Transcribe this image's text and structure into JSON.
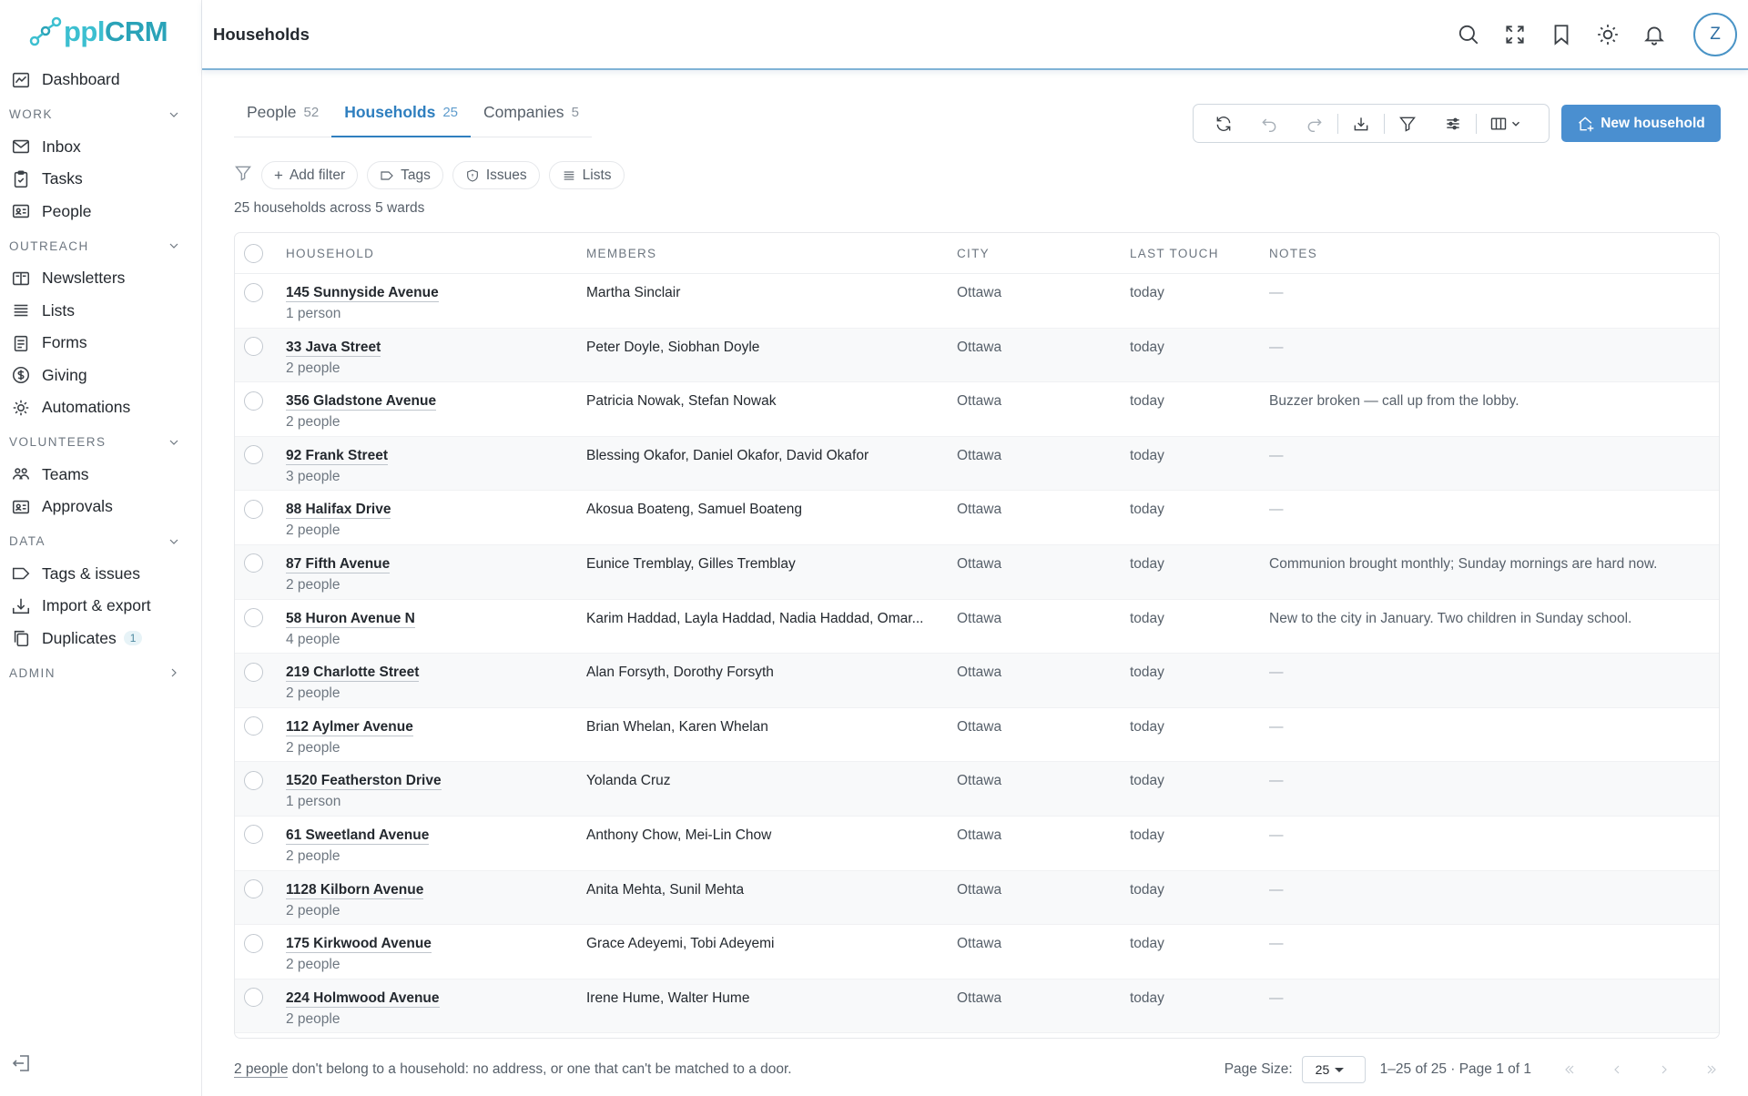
{
  "app": {
    "logo": "ppl",
    "logo_suffix": "CRM",
    "brand_color": "#3cbfd0",
    "accent": "#4a8fd0"
  },
  "header": {
    "title": "Households",
    "avatar_initial": "Z"
  },
  "sidebar": {
    "top": {
      "label": "Dashboard",
      "icon": "dashboard-icon"
    },
    "sections": [
      {
        "title": "WORK",
        "items": [
          {
            "label": "Inbox",
            "icon": "inbox-icon"
          },
          {
            "label": "Tasks",
            "icon": "clipboard-icon"
          },
          {
            "label": "People",
            "icon": "contact-card-icon"
          }
        ]
      },
      {
        "title": "OUTREACH",
        "items": [
          {
            "label": "Newsletters",
            "icon": "newsletter-icon"
          },
          {
            "label": "Lists",
            "icon": "list-icon"
          },
          {
            "label": "Forms",
            "icon": "form-icon"
          },
          {
            "label": "Giving",
            "icon": "dollar-icon"
          },
          {
            "label": "Automations",
            "icon": "gear-icon"
          }
        ]
      },
      {
        "title": "VOLUNTEERS",
        "items": [
          {
            "label": "Teams",
            "icon": "team-icon"
          },
          {
            "label": "Approvals",
            "icon": "approval-card-icon"
          }
        ]
      },
      {
        "title": "DATA",
        "items": [
          {
            "label": "Tags & issues",
            "icon": "tag-icon"
          },
          {
            "label": "Import & export",
            "icon": "import-export-icon"
          },
          {
            "label": "Duplicates",
            "icon": "duplicate-icon",
            "badge": "1"
          }
        ]
      },
      {
        "title": "ADMIN"
      }
    ]
  },
  "tabs": [
    {
      "label": "People",
      "count": "52"
    },
    {
      "label": "Households",
      "count": "25"
    },
    {
      "label": "Companies",
      "count": "5"
    }
  ],
  "new_button": {
    "label": "New household"
  },
  "filters": {
    "add_filter": "Add filter",
    "tags": "Tags",
    "issues": "Issues",
    "lists": "Lists"
  },
  "summary": "25 households across 5 wards",
  "table": {
    "columns": [
      "HOUSEHOLD",
      "MEMBERS",
      "CITY",
      "LAST TOUCH",
      "NOTES"
    ],
    "rows": [
      {
        "household": "145 Sunnyside Avenue",
        "size": "1 person",
        "members": "Martha Sinclair",
        "city": "Ottawa",
        "last": "today",
        "notes": "—"
      },
      {
        "household": "33 Java Street",
        "size": "2 people",
        "members": "Peter Doyle, Siobhan Doyle",
        "city": "Ottawa",
        "last": "today",
        "notes": "—"
      },
      {
        "household": "356 Gladstone Avenue",
        "size": "2 people",
        "members": "Patricia Nowak, Stefan Nowak",
        "city": "Ottawa",
        "last": "today",
        "notes": "Buzzer broken — call up from the lobby."
      },
      {
        "household": "92 Frank Street",
        "size": "3 people",
        "members": "Blessing Okafor, Daniel Okafor, David Okafor",
        "city": "Ottawa",
        "last": "today",
        "notes": "—"
      },
      {
        "household": "88 Halifax Drive",
        "size": "2 people",
        "members": "Akosua Boateng, Samuel Boateng",
        "city": "Ottawa",
        "last": "today",
        "notes": "—"
      },
      {
        "household": "87 Fifth Avenue",
        "size": "2 people",
        "members": "Eunice Tremblay, Gilles Tremblay",
        "city": "Ottawa",
        "last": "today",
        "notes": "Communion brought monthly; Sunday mornings are hard now."
      },
      {
        "household": "58 Huron Avenue N",
        "size": "4 people",
        "members": "Karim Haddad, Layla Haddad, Nadia Haddad, Omar...",
        "city": "Ottawa",
        "last": "today",
        "notes": "New to the city in January. Two children in Sunday school."
      },
      {
        "household": "219 Charlotte Street",
        "size": "2 people",
        "members": "Alan Forsyth, Dorothy Forsyth",
        "city": "Ottawa",
        "last": "today",
        "notes": "—"
      },
      {
        "household": "112 Aylmer Avenue",
        "size": "2 people",
        "members": "Brian Whelan, Karen Whelan",
        "city": "Ottawa",
        "last": "today",
        "notes": "—"
      },
      {
        "household": "1520 Featherston Drive",
        "size": "1 person",
        "members": "Yolanda Cruz",
        "city": "Ottawa",
        "last": "today",
        "notes": "—"
      },
      {
        "household": "61 Sweetland Avenue",
        "size": "2 people",
        "members": "Anthony Chow, Mei-Lin Chow",
        "city": "Ottawa",
        "last": "today",
        "notes": "—"
      },
      {
        "household": "1128 Kilborn Avenue",
        "size": "2 people",
        "members": "Anita Mehta, Sunil Mehta",
        "city": "Ottawa",
        "last": "today",
        "notes": "—"
      },
      {
        "household": "175 Kirkwood Avenue",
        "size": "2 people",
        "members": "Grace Adeyemi, Tobi Adeyemi",
        "city": "Ottawa",
        "last": "today",
        "notes": "—"
      },
      {
        "household": "224 Holmwood Avenue",
        "size": "2 people",
        "members": "Irene Hume, Walter Hume",
        "city": "Ottawa",
        "last": "today",
        "notes": "—"
      }
    ]
  },
  "footer": {
    "note_link": "2 people",
    "note_text": " don't belong to a household: no address, or one that can't be matched to a door.",
    "page_size_label": "Page Size:",
    "page_size": "25",
    "range": "1–25 of 25 · Page 1 of 1"
  }
}
